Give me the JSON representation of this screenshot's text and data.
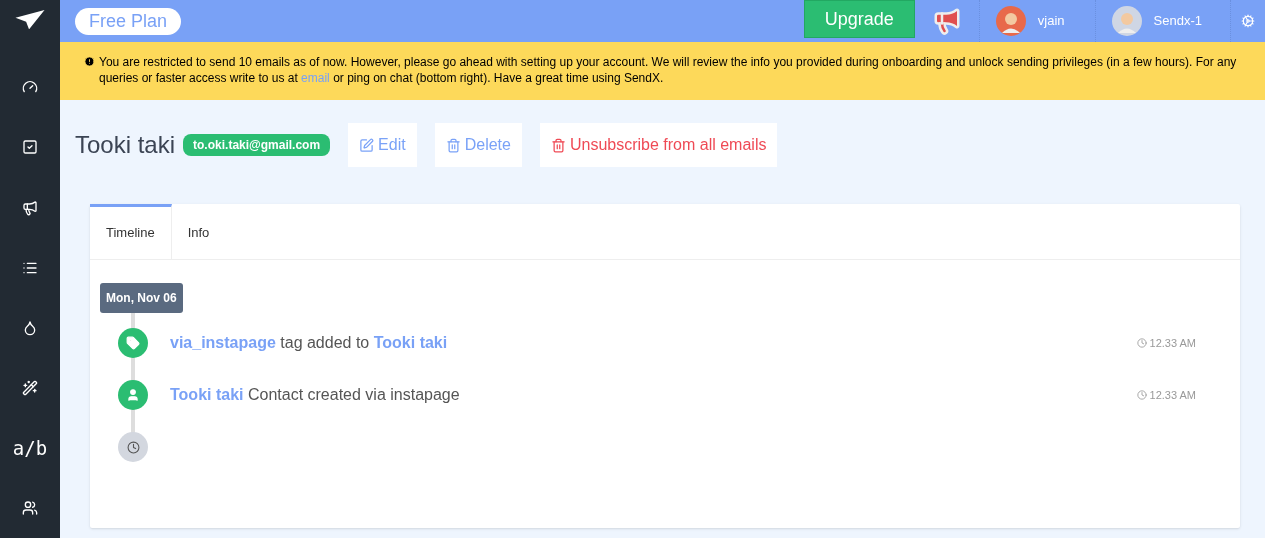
{
  "sidebar": {
    "items": [
      {
        "kind": "icon"
      },
      {
        "kind": "icon"
      },
      {
        "kind": "icon"
      },
      {
        "kind": "icon"
      },
      {
        "kind": "icon"
      },
      {
        "kind": "icon"
      },
      {
        "kind": "text",
        "label": "a/b"
      },
      {
        "kind": "icon"
      }
    ]
  },
  "topbar": {
    "plan": "Free Plan",
    "upgrade": "Upgrade",
    "user": "vjain",
    "team": "Sendx-1"
  },
  "banner": {
    "before": "You are restricted to send 10 emails as of now. However, please go ahead with setting up your account. We will review the info you provided during onboarding and unlock sending privileges (in a few hours). For any queries or faster access write to us at",
    "link": "email",
    "after": "or ping on chat (bottom right). Have a great time using SendX."
  },
  "contact": {
    "name": "Tooki taki",
    "email": "to.oki.taki@gmail.com",
    "actions": [
      {
        "kind": "edit",
        "label": "Edit"
      },
      {
        "kind": "delete",
        "label": "Delete"
      },
      {
        "kind": "unsubscribe",
        "label": "Unsubscribe from all emails"
      }
    ]
  },
  "tabs": [
    {
      "label": "Timeline",
      "selected": true
    },
    {
      "label": "Info",
      "selected": false
    }
  ],
  "timeline": {
    "date": "Mon, Nov 06",
    "events": [
      {
        "kind": "tag",
        "parts": [
          {
            "kind": "link",
            "text": "via_instapage"
          },
          {
            "kind": "text",
            "text": "tag added to"
          },
          {
            "kind": "link",
            "text": "Tooki taki"
          }
        ],
        "time": "12.33 AM"
      },
      {
        "kind": "contact",
        "parts": [
          {
            "kind": "link",
            "text": "Tooki taki"
          },
          {
            "kind": "text",
            "text": "Contact created via instapage"
          }
        ],
        "time": "12.33 AM"
      }
    ]
  }
}
